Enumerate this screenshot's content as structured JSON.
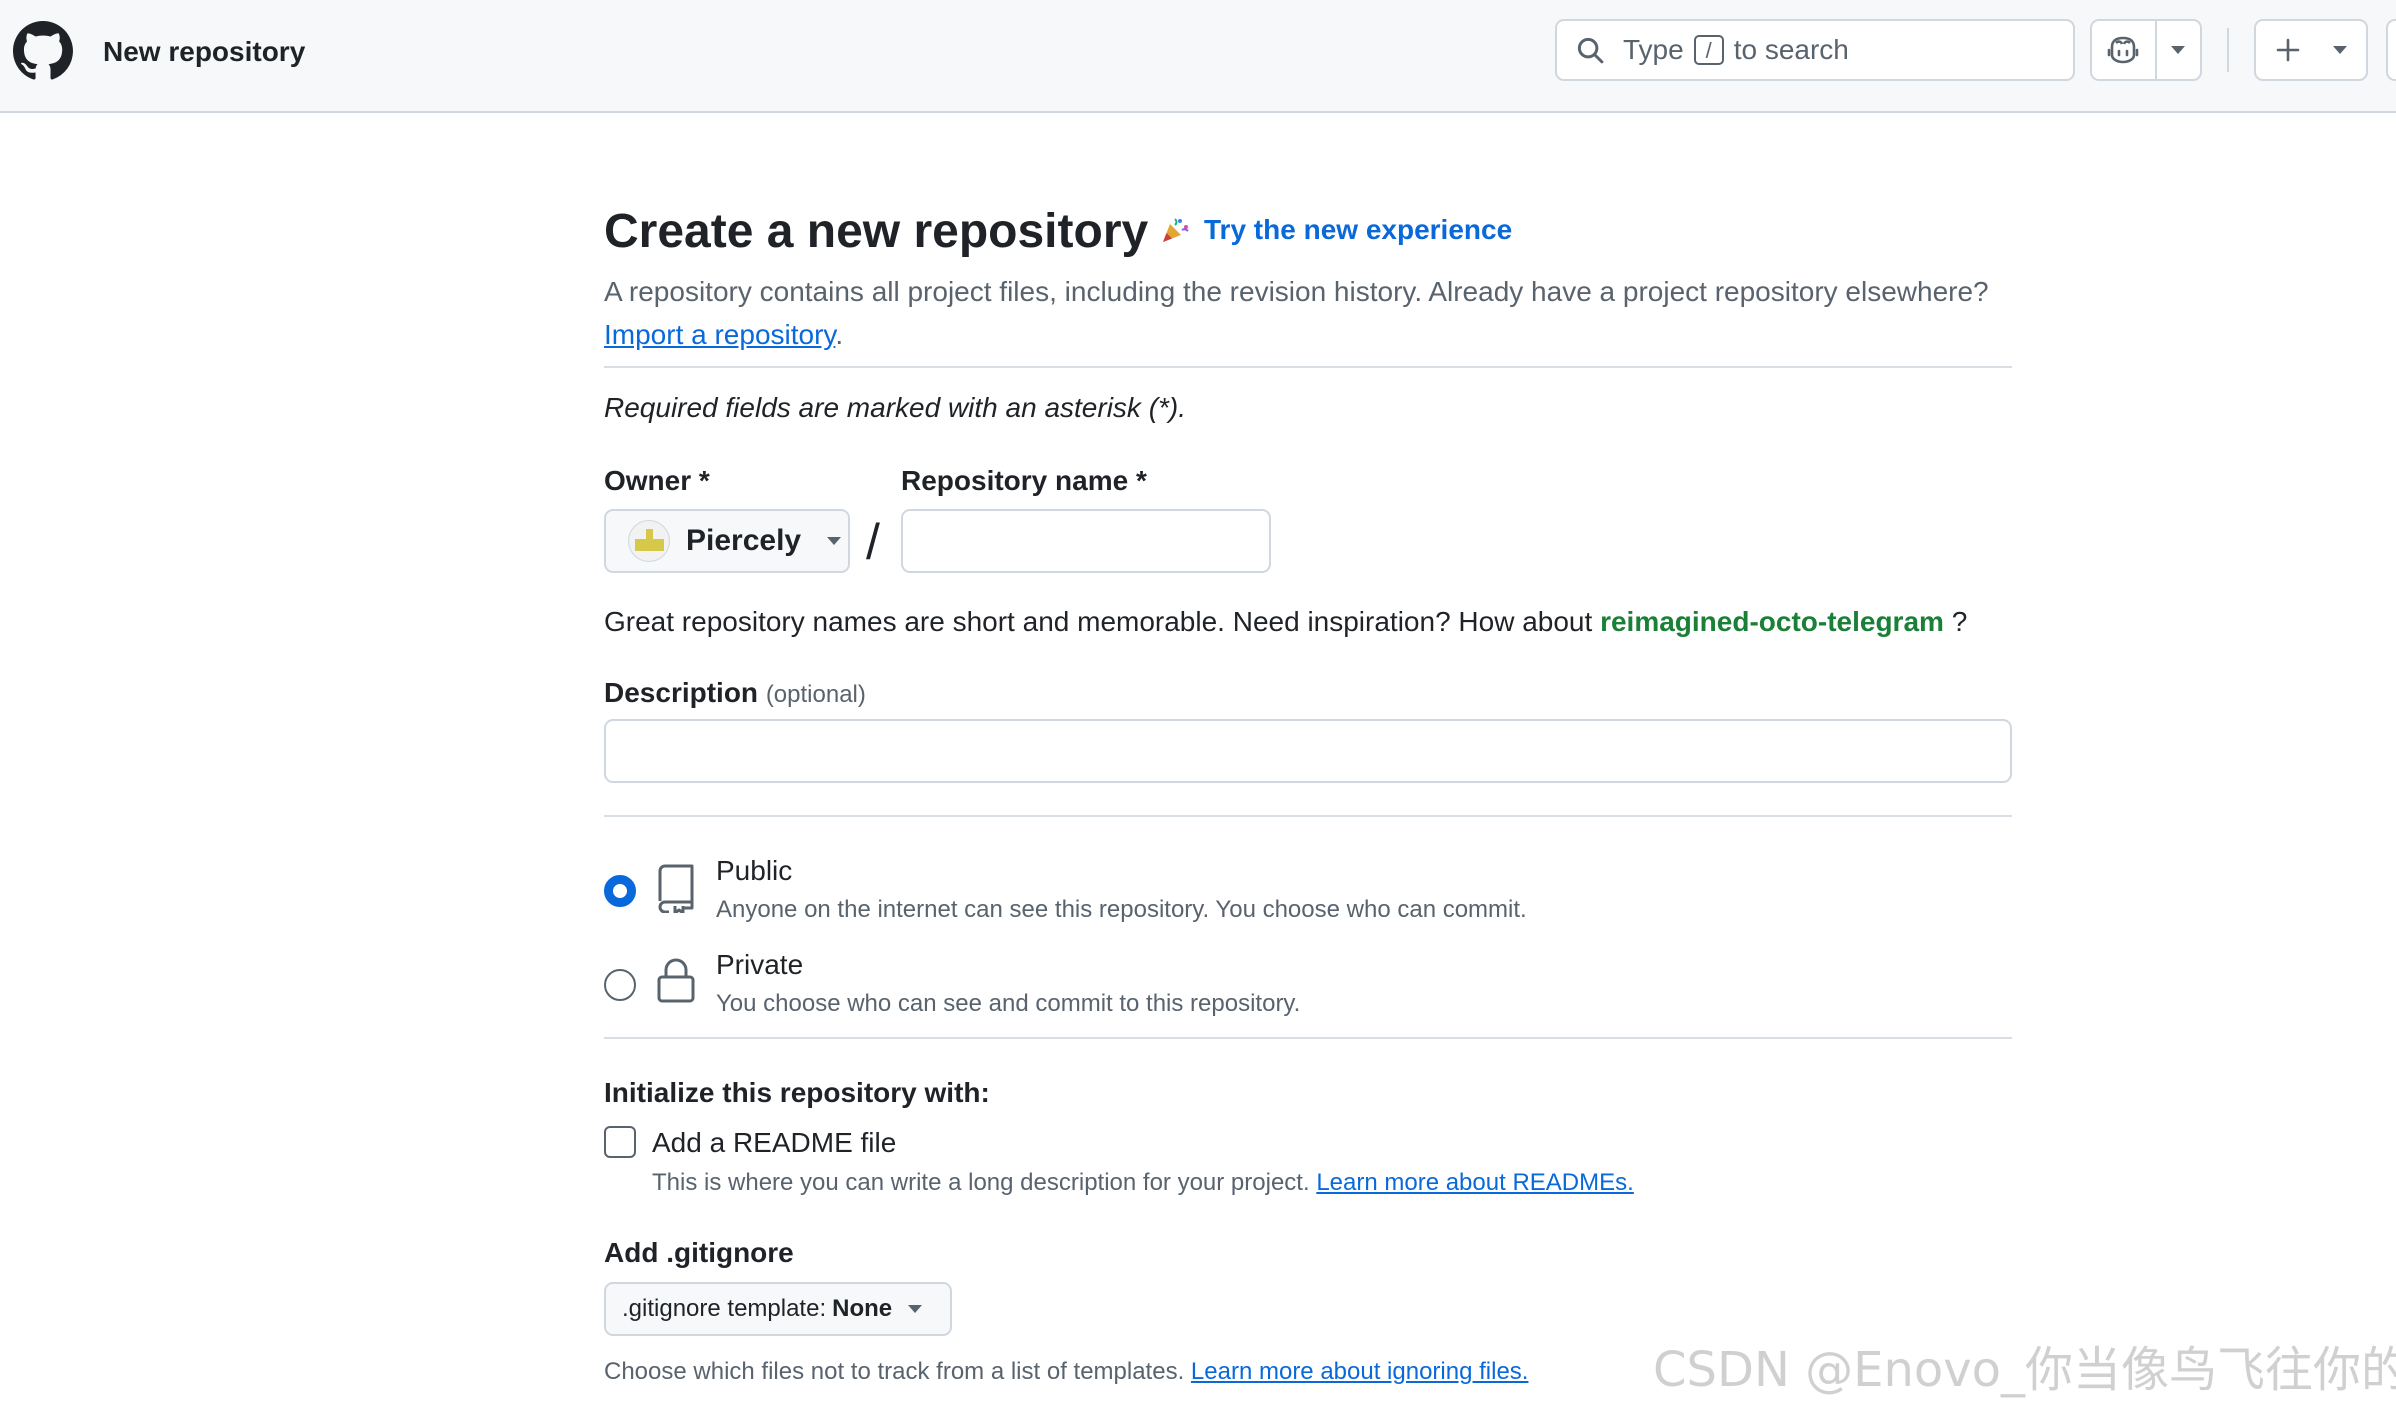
{
  "header": {
    "title": "New repository",
    "search": {
      "prefix": "Type",
      "key": "/",
      "suffix": "to search"
    }
  },
  "page": {
    "title": "Create a new repository",
    "try_new_label": "Try the new experience",
    "intro_text": "A repository contains all project files, including the revision history. Already have a project repository elsewhere?",
    "import_link": "Import a repository",
    "required_note": "Required fields are marked with an asterisk (*)."
  },
  "owner": {
    "label": "Owner *",
    "value": "Piercely"
  },
  "repo_name": {
    "label": "Repository name *",
    "value": "",
    "separator": "/"
  },
  "hint": {
    "text": "Great repository names are short and memorable. Need inspiration? How about",
    "suggestion": "reimagined-octo-telegram",
    "end": "?"
  },
  "description": {
    "label": "Description",
    "optional": "(optional)",
    "value": ""
  },
  "visibility": {
    "selected": "public",
    "options": [
      {
        "id": "public",
        "title": "Public",
        "desc": "Anyone on the internet can see this repository. You choose who can commit."
      },
      {
        "id": "private",
        "title": "Private",
        "desc": "You choose who can see and commit to this repository."
      }
    ]
  },
  "init": {
    "heading": "Initialize this repository with:",
    "readme": {
      "title": "Add a README file",
      "desc": "This is where you can write a long description for your project.",
      "link": "Learn more about READMEs.",
      "checked": false
    }
  },
  "gitignore": {
    "heading": "Add .gitignore",
    "select_prefix": ".gitignore template:",
    "select_value": "None",
    "note": "Choose which files not to track from a list of templates.",
    "link": "Learn more about ignoring files."
  },
  "watermark": "CSDN @Enovo_你当像鸟飞往你的山",
  "colors": {
    "accent": "#0969da",
    "success": "#1a7f37",
    "border": "#d0d7de",
    "muted": "#59636e"
  }
}
